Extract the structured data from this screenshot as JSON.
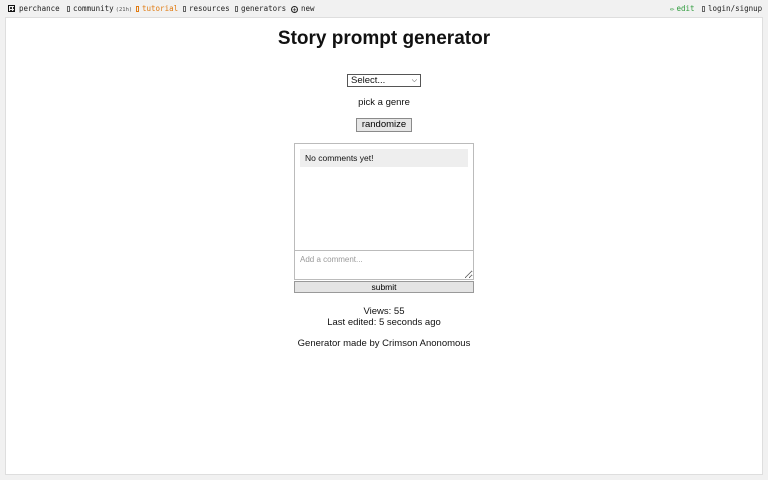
{
  "nav": {
    "logo_label": "perchance",
    "community_label": "community",
    "community_badge": "(21h)",
    "tutorial_label": "tutorial",
    "resources_label": "resources",
    "generators_label": "generators",
    "new_label": "new",
    "edit_label": "edit",
    "login_label": "login/signup",
    "colors": {
      "tutorial": "#e07b12",
      "edit": "#2e9b3c"
    }
  },
  "main": {
    "title": "Story prompt generator",
    "select_value": "Select...",
    "hint": "pick a genre",
    "randomize_label": "randomize"
  },
  "comments": {
    "empty_text": "No comments yet!",
    "input_placeholder": "Add a comment...",
    "submit_label": "submit"
  },
  "stats": {
    "views": "Views: 55",
    "last_edited": "Last edited: 5 seconds ago",
    "made_by_prefix": "Generator made by ",
    "author": "Crimson Anonomous"
  }
}
